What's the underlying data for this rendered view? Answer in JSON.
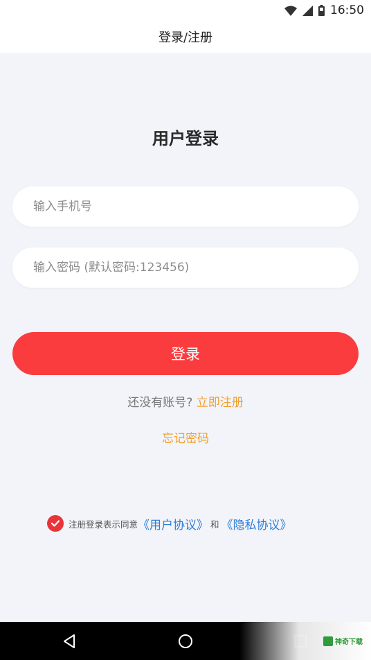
{
  "status_bar": {
    "time": "16:50",
    "icons": [
      "wifi-icon",
      "cellular-signal-icon",
      "battery-icon"
    ]
  },
  "app_bar": {
    "title": "登录/注册"
  },
  "login": {
    "heading": "用户登录",
    "phone": {
      "placeholder": "输入手机号",
      "value": ""
    },
    "password": {
      "placeholder": "输入密码 (默认密码:123456)",
      "value": ""
    },
    "submit_label": "登录",
    "register_prompt": "还没有账号?",
    "register_link": "立即注册",
    "forgot_link": "忘记密码"
  },
  "agreement": {
    "checked": true,
    "prefix": "注册登录表示同意",
    "user_agreement": "《用户协议》",
    "and": "和",
    "privacy_policy": "《隐私协议》"
  },
  "nav_bar": {
    "icons": [
      "back-icon",
      "home-icon",
      "recent-apps-icon"
    ]
  },
  "watermark": {
    "text": "神奇下载"
  },
  "colors": {
    "background": "#f2f4fa",
    "primary_button": "#fa3c3e",
    "link_orange": "#f2a02e",
    "link_blue": "#2f7fd6",
    "check": "#e8353a"
  }
}
